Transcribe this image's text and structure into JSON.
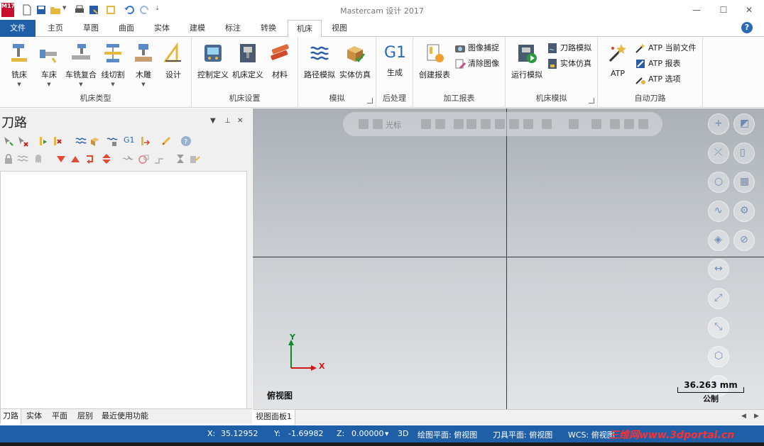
{
  "window": {
    "title": "Mastercam 设计 2017",
    "logo_text": "M17",
    "minimize": "—",
    "maximize": "☐",
    "close": "✕"
  },
  "ribbon_tabs": [
    "文件",
    "主页",
    "草图",
    "曲面",
    "实体",
    "建模",
    "标注",
    "转换",
    "机床",
    "视图"
  ],
  "active_tab": "机床",
  "ribbon": {
    "machine_type": {
      "label": "机床类型",
      "buttons": [
        "铣床",
        "车床",
        "车铣复合",
        "线切割",
        "木雕",
        "设计"
      ]
    },
    "machine_setup": {
      "label": "机床设置",
      "buttons": [
        "控制定义",
        "机床定义",
        "材料"
      ]
    },
    "simulate": {
      "label": "模拟",
      "buttons": [
        "路径模拟",
        "实体仿真"
      ]
    },
    "post": {
      "label": "后处理",
      "g1": "G1",
      "buttons": [
        "生成"
      ]
    },
    "setup_sheet": {
      "label": "加工报表",
      "big": "创建报表",
      "small": [
        "图像捕捉",
        "清除图像"
      ]
    },
    "machine_sim": {
      "label": "机床模拟",
      "big": "运行模拟",
      "small": [
        "刀路模拟",
        "实体仿真"
      ]
    },
    "auto_toolpath": {
      "label": "自动刀路",
      "big": "ATP",
      "small": [
        "ATP 当前文件",
        "ATP 报表",
        "ATP 选项"
      ]
    }
  },
  "panel": {
    "title": "刀路",
    "pin": "ᵖ",
    "menu": "▼",
    "close": "✕",
    "g1": "G1",
    "tabs": [
      "刀路",
      "实体",
      "平面",
      "层别",
      "最近使用功能"
    ]
  },
  "viewport": {
    "toolbar_label": "光标",
    "view_name": "俯视图",
    "scale_value": "36.263 mm",
    "scale_unit": "公制",
    "axis_x": "X",
    "axis_y": "Y",
    "tab": "视图面板1"
  },
  "status": {
    "x_label": "X:",
    "x_value": "35.12952",
    "y_label": "Y:",
    "y_value": "-1.69982",
    "z_label": "Z:",
    "z_value": "0.00000",
    "mode": "3D",
    "cplane": "绘图平面: 俯视图",
    "tplane": "刀具平面: 俯视图",
    "wcs": "WCS: 俯视图",
    "watermark": "三维网www.3dportal.cn"
  },
  "colors": {
    "accent": "#1e5fa8",
    "axis_x": "#d01818",
    "axis_y": "#0a8a2a"
  }
}
